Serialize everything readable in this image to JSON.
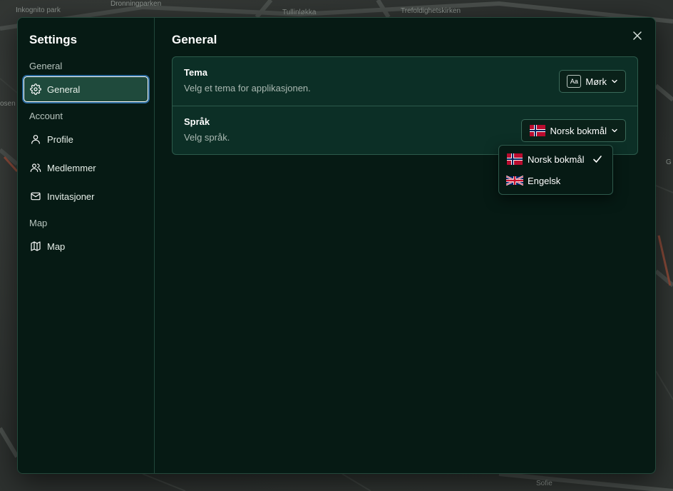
{
  "map": {
    "labels": [
      "Inkognito park",
      "Dronningparken",
      "Tullinløkka",
      "Trefoldighetskirken",
      "osen",
      "Sofie",
      "G"
    ]
  },
  "sidebar": {
    "title": "Settings",
    "sections": [
      {
        "label": "General",
        "items": [
          {
            "label": "General",
            "icon": "gear-icon",
            "active": true
          }
        ]
      },
      {
        "label": "Account",
        "items": [
          {
            "label": "Profile",
            "icon": "user-icon"
          },
          {
            "label": "Medlemmer",
            "icon": "users-icon"
          },
          {
            "label": "Invitasjoner",
            "icon": "mail-icon"
          }
        ]
      },
      {
        "label": "Map",
        "items": [
          {
            "label": "Map",
            "icon": "map-icon"
          }
        ]
      }
    ]
  },
  "main": {
    "title": "General",
    "settings": [
      {
        "title": "Tema",
        "description": "Velg et tema for applikasjonen.",
        "badge": "Aa",
        "value": "Mørk"
      },
      {
        "title": "Språk",
        "description": "Velg språk.",
        "value": "Norsk bokmål"
      }
    ],
    "language_dropdown": {
      "options": [
        {
          "label": "Norsk bokmål",
          "flag": "norway-flag-icon",
          "selected": true
        },
        {
          "label": "Engelsk",
          "flag": "uk-flag-icon",
          "selected": false
        }
      ]
    }
  },
  "colors": {
    "modal_bg": "#061a14",
    "card_bg": "#0c2f26",
    "active_item_bg": "#1f4a3c",
    "focus_ring": "#2a6a9c"
  }
}
